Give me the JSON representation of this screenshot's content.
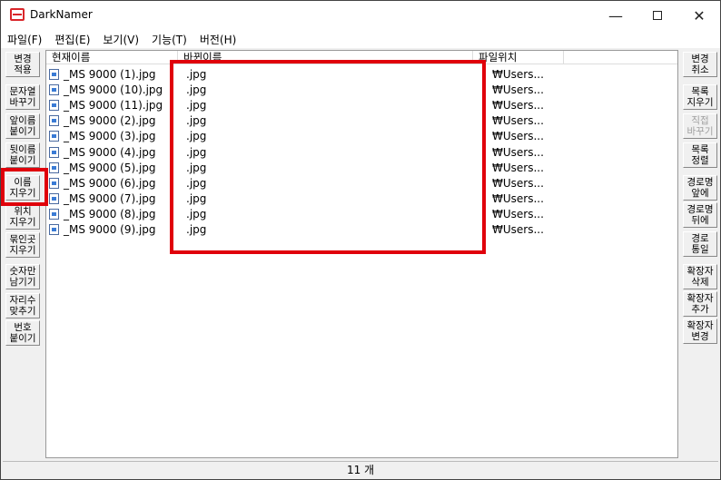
{
  "window": {
    "title": "DarkNamer",
    "minimize": "—",
    "close": "✕"
  },
  "menu": [
    "파일(F)",
    "편집(E)",
    "보기(V)",
    "기능(T)",
    "버전(H)"
  ],
  "left_buttons": [
    {
      "label": "변경\n적용",
      "enabled": true
    },
    {
      "label": "문자열\n바꾸기",
      "enabled": true
    },
    {
      "label": "앞이름\n붙이기",
      "enabled": true
    },
    {
      "label": "뒷이름\n붙이기",
      "enabled": true
    },
    {
      "label": "이름\n지우기",
      "enabled": true
    },
    {
      "label": "위치\n지우기",
      "enabled": true
    },
    {
      "label": "묶인곳\n지우기",
      "enabled": true
    },
    {
      "label": "숫자만\n남기기",
      "enabled": true
    },
    {
      "label": "자리수\n맞추기",
      "enabled": true
    },
    {
      "label": "번호\n붙이기",
      "enabled": true
    }
  ],
  "right_buttons": [
    {
      "label": "변경\n취소",
      "enabled": true
    },
    {
      "label": "목록\n지우기",
      "enabled": true
    },
    {
      "label": "직접\n바꾸기",
      "enabled": false
    },
    {
      "label": "목록\n정렬",
      "enabled": true
    },
    {
      "label": "경로명\n앞에",
      "enabled": true
    },
    {
      "label": "경로명\n뒤에",
      "enabled": true
    },
    {
      "label": "경로\n통일",
      "enabled": true
    },
    {
      "label": "확장자\n삭제",
      "enabled": true
    },
    {
      "label": "확장자\n추가",
      "enabled": true
    },
    {
      "label": "확장자\n변경",
      "enabled": true
    }
  ],
  "columns": {
    "current": "현재이름",
    "changed": "바뀐이름",
    "location": "파일위치"
  },
  "rows": [
    {
      "current": "_MS 9000 (1).jpg",
      "changed": ".jpg",
      "location": "₩Users..."
    },
    {
      "current": "_MS 9000 (10).jpg",
      "changed": ".jpg",
      "location": "₩Users..."
    },
    {
      "current": "_MS 9000 (11).jpg",
      "changed": ".jpg",
      "location": "₩Users..."
    },
    {
      "current": "_MS 9000 (2).jpg",
      "changed": ".jpg",
      "location": "₩Users..."
    },
    {
      "current": "_MS 9000 (3).jpg",
      "changed": ".jpg",
      "location": "₩Users..."
    },
    {
      "current": "_MS 9000 (4).jpg",
      "changed": ".jpg",
      "location": "₩Users..."
    },
    {
      "current": "_MS 9000 (5).jpg",
      "changed": ".jpg",
      "location": "₩Users..."
    },
    {
      "current": "_MS 9000 (6).jpg",
      "changed": ".jpg",
      "location": "₩Users..."
    },
    {
      "current": "_MS 9000 (7).jpg",
      "changed": ".jpg",
      "location": "₩Users..."
    },
    {
      "current": "_MS 9000 (8).jpg",
      "changed": ".jpg",
      "location": "₩Users..."
    },
    {
      "current": "_MS 9000 (9).jpg",
      "changed": ".jpg",
      "location": "₩Users..."
    }
  ],
  "status": {
    "count": "11 개"
  },
  "colors": {
    "highlight": "#e0000b",
    "app_icon": "#d9262a"
  }
}
